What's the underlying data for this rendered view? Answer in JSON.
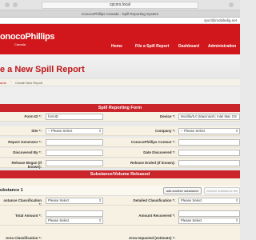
{
  "browser": {
    "url": "cpcsrs.local",
    "tab_title": "ConocoPhillips Canada - Spill Reporting System"
  },
  "util": {
    "email": "spcrl@mobiledig.net"
  },
  "header": {
    "logo": "onocoPhillips",
    "logo_sub": "Canada",
    "nav": [
      "Home",
      "File a Spill Report",
      "Dashboard",
      "Administration"
    ]
  },
  "page": {
    "title": "e a New Spill Report",
    "breadcrumb": [
      "ards",
      "Create New Report"
    ]
  },
  "spill_form": {
    "heading": "Spill Reporting Form",
    "rows": [
      {
        "left_label": "Form ID *:",
        "left_value": "formID",
        "left_type": "text",
        "right_label": "Device *:",
        "right_value": "Mozilla/5.0 (Macintosh; Intel Mac OS",
        "right_type": "text"
      },
      {
        "left_label": "Site *:",
        "left_value": "-- Please Select",
        "left_type": "select",
        "right_label": "Company *:",
        "right_value": "-- Please Select",
        "right_type": "select"
      },
      {
        "left_label": "Report Generator *:",
        "left_value": "",
        "left_type": "text",
        "right_label": "ConocoPhillips Contact *:",
        "right_value": "",
        "right_type": "text"
      },
      {
        "left_label": "Discovered By *:",
        "left_value": "",
        "left_type": "text",
        "right_label": "Date Discovered *:",
        "right_value": "",
        "right_type": "text"
      },
      {
        "left_label": "Release Began (If known):",
        "left_value": "",
        "left_type": "text",
        "right_label": "Release Ended (If known):",
        "right_value": "",
        "right_type": "text"
      }
    ]
  },
  "substance_section": {
    "heading": "Substance/Volume Released",
    "subtitle": "ubstance 1",
    "add_button": "add another substance",
    "remove_button": "remove substance bel",
    "rows": [
      {
        "left_label": "ostance Classification *:",
        "left_value": "Please Select",
        "left_type": "select",
        "right_label": "Detailed Classification *:",
        "right_value": "Please Select",
        "right_type": "select"
      },
      {
        "left_label": "Total Amount *:",
        "left_value": "",
        "left_type": "text",
        "right_label": "Amount Recovered *:",
        "right_value": "",
        "right_type": "text"
      },
      {
        "left_label": "",
        "left_value": "Please Select",
        "left_type": "select",
        "right_label": "",
        "right_value": "Please Select",
        "right_type": "select"
      }
    ],
    "last_row_labels": [
      "Area Classification *:",
      "Area Impacted (estimate) *:"
    ]
  }
}
